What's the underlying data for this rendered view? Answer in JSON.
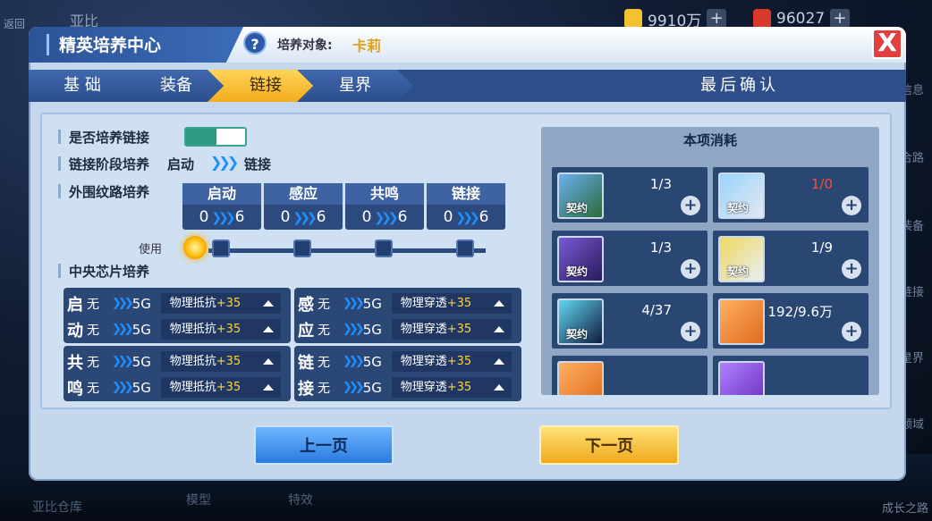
{
  "hud": {
    "currency1": "9910万",
    "currency2": "96027",
    "back_label": "返回",
    "top_left_label": "亚比",
    "bottom_left_label": "亚比仓库",
    "bottom_items": [
      "模型",
      "特效"
    ],
    "right_labels": [
      "信息",
      "合路",
      "装备",
      "链接",
      "星界",
      "领域",
      "成长之路"
    ]
  },
  "panel": {
    "title": "精英培养中心",
    "help_icon": "?",
    "target_label": "培养对象:",
    "target_value": "卡莉",
    "close_icon": "X"
  },
  "tabs": [
    {
      "label": "基 础",
      "active": false
    },
    {
      "label": "装备",
      "active": false
    },
    {
      "label": "链接",
      "active": true
    },
    {
      "label": "星界",
      "active": false
    }
  ],
  "confirm_tab": "最后确认",
  "link": {
    "train_toggle_label": "是否培养链接",
    "toggle_on": true,
    "stage_train_label": "链接阶段培养",
    "stage_from": "启动",
    "stage_to": "链接",
    "outer_label": "外围纹路培养",
    "stages": [
      {
        "name": "启动",
        "from": "0",
        "to": "6"
      },
      {
        "name": "感应",
        "from": "0",
        "to": "6"
      },
      {
        "name": "共鸣",
        "from": "0",
        "to": "6"
      },
      {
        "name": "链接",
        "from": "0",
        "to": "6"
      }
    ],
    "use_label": "使用",
    "chip_label": "中央芯片培养",
    "chip_groups": [
      {
        "rows": [
          {
            "char": "启",
            "from": "无",
            "to": "5G",
            "stat": "物理抵抗",
            "bonus": "+35"
          },
          {
            "char": "动",
            "from": "无",
            "to": "5G",
            "stat": "物理抵抗",
            "bonus": "+35"
          }
        ]
      },
      {
        "rows": [
          {
            "char": "感",
            "from": "无",
            "to": "5G",
            "stat": "物理穿透",
            "bonus": "+35"
          },
          {
            "char": "应",
            "from": "无",
            "to": "5G",
            "stat": "物理穿透",
            "bonus": "+35"
          }
        ]
      },
      {
        "rows": [
          {
            "char": "共",
            "from": "无",
            "to": "5G",
            "stat": "物理抵抗",
            "bonus": "+35"
          },
          {
            "char": "鸣",
            "from": "无",
            "to": "5G",
            "stat": "物理抵抗",
            "bonus": "+35"
          }
        ]
      },
      {
        "rows": [
          {
            "char": "链",
            "from": "无",
            "to": "5G",
            "stat": "物理穿透",
            "bonus": "+35"
          },
          {
            "char": "接",
            "from": "无",
            "to": "5G",
            "stat": "物理穿透",
            "bonus": "+35"
          }
        ]
      }
    ]
  },
  "cost": {
    "title": "本项消耗",
    "items": [
      {
        "qty": "1/3",
        "tag": "契约",
        "short": false,
        "color": "#5aa0e0"
      },
      {
        "qty": "1/0",
        "tag": "契约",
        "short": true,
        "color": "#7ec0f0"
      },
      {
        "qty": "1/3",
        "tag": "契约",
        "short": false,
        "color": "#6a5ab8"
      },
      {
        "qty": "1/9",
        "tag": "契约",
        "short": false,
        "color": "#e0c040"
      },
      {
        "qty": "4/37",
        "tag": "契约",
        "short": false,
        "color": "#3a5ac0"
      },
      {
        "qty": "192/9.6万",
        "tag": "",
        "short": false,
        "color": "#f08a30"
      },
      {
        "qty": "",
        "tag": "",
        "short": false,
        "color": "#f08a30"
      },
      {
        "qty": "",
        "tag": "",
        "short": false,
        "color": "#9a5ae0"
      }
    ]
  },
  "buttons": {
    "prev": "上一页",
    "next": "下一页"
  }
}
